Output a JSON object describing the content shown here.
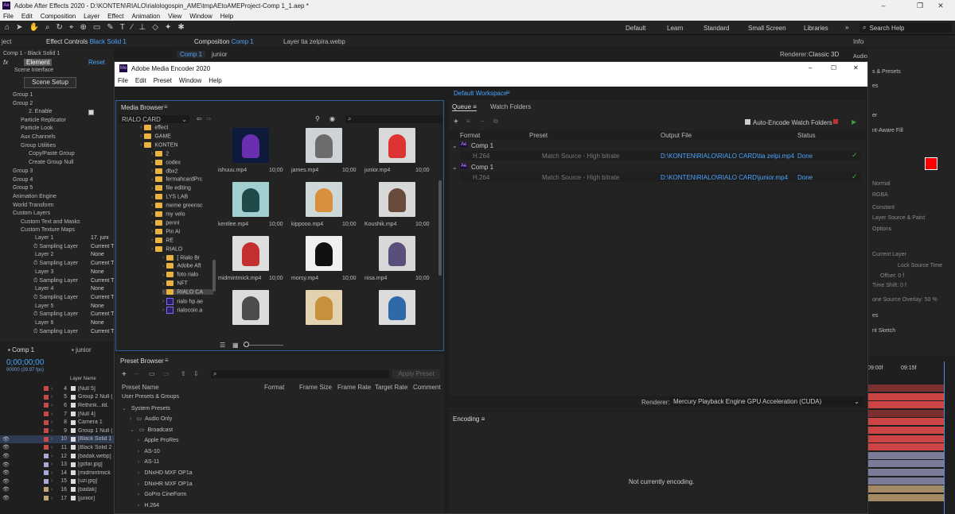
{
  "ae": {
    "title": "Adobe After Effects 2020 - D:\\KONTEN\\RIALO\\rialologospin_AME\\tmpAEtoAMEProject-Comp 1_1.aep *",
    "menu": [
      "File",
      "Edit",
      "Composition",
      "Layer",
      "Effect",
      "Animation",
      "View",
      "Window",
      "Help"
    ],
    "workspaces": [
      "Default",
      "Learn",
      "Standard",
      "Small Screen",
      "Libraries"
    ],
    "search_placeholder": "Search Help",
    "effect_controls_tab": "Effect Controls",
    "effect_controls_layer": "Black Solid 1",
    "comp_tab": "Composition",
    "comp_name": "Comp 1",
    "layer_tab": "Layer tia zelpira.webp",
    "comp_subtabs": [
      "Comp 1",
      "junior"
    ],
    "renderer_label": "Renderer:",
    "renderer_value": "Classic 3D",
    "panel_left": "ject",
    "effects_header": "Comp 1 - Black Solid 1",
    "element_label": "Element",
    "reset_label": "Reset",
    "fx_rows": [
      "Scene Interface",
      "Group 1",
      "Group 2",
      "2. Enable",
      "Particle Replicator",
      "Particle Look",
      "Aux Channels",
      "Group Utilities",
      "Copy/Paste Group",
      "Create Group Null",
      "Group 3",
      "Group 4",
      "Group 5",
      "Animation Engine",
      "World Transform",
      "Custom Layers",
      "Custom Text and Masks",
      "Custom Texture Maps"
    ],
    "scene_setup": "Scene Setup",
    "tex_layers": [
      [
        "Layer 1",
        "17. juni"
      ],
      [
        "Sampling Layer",
        "Current T"
      ],
      [
        "Layer 2",
        "None"
      ],
      [
        "Sampling Layer",
        "Current T"
      ],
      [
        "Layer 3",
        "None"
      ],
      [
        "Sampling Layer",
        "Current T"
      ],
      [
        "Layer 4",
        "None"
      ],
      [
        "Sampling Layer",
        "Current T"
      ],
      [
        "Layer 5",
        "None"
      ],
      [
        "Sampling Layer",
        "Current T"
      ],
      [
        "Layer 6",
        "None"
      ],
      [
        "Sampling Layer",
        "Current T"
      ]
    ],
    "timeline_tabs": [
      "Comp 1",
      "junior"
    ],
    "timecode": "0;00;00;00",
    "timecode_sub": "00000 (29.97 fps)",
    "layer_name_header": "Layer Name",
    "layers": [
      {
        "n": "4",
        "name": "[Null 5]",
        "c": "#c94848"
      },
      {
        "n": "5",
        "name": "Group 2 Null (",
        "c": "#c94848"
      },
      {
        "n": "6",
        "name": "Rethink...ild.",
        "c": "#c94848"
      },
      {
        "n": "7",
        "name": "[Null 4]",
        "c": "#c94848"
      },
      {
        "n": "8",
        "name": "Camera 1",
        "c": "#c94848"
      },
      {
        "n": "9",
        "name": "Group 1 Null (",
        "c": "#c94848"
      },
      {
        "n": "10",
        "name": "[Black Solid 1",
        "c": "#c94848"
      },
      {
        "n": "11",
        "name": "[Black Solid 2",
        "c": "#c94848"
      },
      {
        "n": "12",
        "name": "[badak.webp]",
        "c": "#a9a9d6"
      },
      {
        "n": "13",
        "name": "[gofar.jpg]",
        "c": "#a9a9d6"
      },
      {
        "n": "14",
        "name": "[midmintmick",
        "c": "#a9a9d6"
      },
      {
        "n": "15",
        "name": "[uzi.jpg]",
        "c": "#a9a9d6"
      },
      {
        "n": "16",
        "name": "[badak]",
        "c": "#c2a878"
      },
      {
        "n": "17",
        "name": "[junior]",
        "c": "#c2a878"
      }
    ],
    "right_panel": [
      "Info",
      "Audio",
      "s & Presets",
      "es",
      "er",
      "nt-Aware Fill",
      "Normal",
      "RGBA",
      "Constant",
      "Layer Source & Paint",
      "Options",
      "Current Layer",
      "Lock Source Time",
      "Offset: 0 f",
      "Time Shift: 0 f",
      "one Source Overlay: 50 %",
      "es",
      "nt Sketch"
    ],
    "ruler": [
      "09:00f",
      "09:15f"
    ]
  },
  "ame": {
    "title": "Adobe Media Encoder 2020",
    "menu": [
      "File",
      "Edit",
      "Preset",
      "Window",
      "Help"
    ],
    "workspace": "Default Workspace",
    "media_browser": "Media Browser",
    "location": "RIALO CARD",
    "folders": [
      [
        "effect",
        1
      ],
      [
        "GAME",
        1
      ],
      [
        "KONTEN",
        1
      ],
      [
        "2",
        2
      ],
      [
        "codex",
        2
      ],
      [
        "dbx2",
        2
      ],
      [
        "fermahcardPrc",
        2
      ],
      [
        "file editing",
        2
      ],
      [
        "LYS LAB",
        2
      ],
      [
        "meme greensc",
        2
      ],
      [
        "my velo",
        2
      ],
      [
        "penni",
        2
      ],
      [
        "Pin Ai",
        2
      ],
      [
        "RE",
        2
      ],
      [
        "RIALO",
        2
      ],
      [
        "[ Rialo Br",
        3
      ],
      [
        "Adobe Aft",
        3
      ],
      [
        "foto rialo",
        3
      ],
      [
        "NFT",
        3
      ],
      [
        "RIALO CA",
        3
      ],
      [
        "rialo hp.ae",
        3
      ],
      [
        "rialocoin.a",
        3
      ]
    ],
    "media": [
      {
        "name": "ishuuu.mp4",
        "dur": "10;00"
      },
      {
        "name": "james.mp4",
        "dur": "10;00"
      },
      {
        "name": "junior.mp4",
        "dur": "10;00"
      },
      {
        "name": "kentlee.mp4",
        "dur": "10;00"
      },
      {
        "name": "kippooo.mp4",
        "dur": "10;00"
      },
      {
        "name": "Koushik.mp4",
        "dur": "10;00"
      },
      {
        "name": "midmintmick.mp4",
        "dur": "10;00"
      },
      {
        "name": "morsy.mp4",
        "dur": "10;00"
      },
      {
        "name": "nisa.mp4",
        "dur": "10;00"
      }
    ],
    "queue_tab": "Queue",
    "watch_tab": "Watch Folders",
    "auto_encode": "Auto-Encode Watch Folders",
    "queue_headers": [
      "Format",
      "Preset",
      "Output File",
      "Status"
    ],
    "queue": [
      {
        "comp": "Comp 1",
        "format": "H.264",
        "preset": "Match Source - High bitrate",
        "output": "D:\\KONTEN\\RIALO\\RIALO CARD\\tia zelpi.mp4",
        "status": "Done"
      },
      {
        "comp": "Comp 1",
        "format": "H.264",
        "preset": "Match Source - High bitrate",
        "output": "D:\\KONTEN\\RIALO\\RIALO CARD\\junior.mp4",
        "status": "Done"
      }
    ],
    "renderer_label": "Renderer:",
    "renderer_value": "Mercury Playback Engine GPU Acceleration (CUDA)",
    "preset_browser": "Preset Browser",
    "apply_preset": "Apply Preset",
    "preset_headers": [
      "Preset Name",
      "Format",
      "Frame Size",
      "Frame Rate",
      "Target Rate",
      "Comment"
    ],
    "preset_rows": [
      [
        "User Presets & Groups",
        0
      ],
      [
        "System Presets",
        0
      ],
      [
        "Audio Only",
        1
      ],
      [
        "Broadcast",
        1
      ],
      [
        "Apple ProRes",
        2
      ],
      [
        "AS-10",
        2
      ],
      [
        "AS-11",
        2
      ],
      [
        "DNxHD MXF OP1a",
        2
      ],
      [
        "DNxHR MXF OP1a",
        2
      ],
      [
        "GoPro CineForm",
        2
      ],
      [
        "H.264",
        2
      ]
    ],
    "encoding_tab": "Encoding",
    "not_encoding": "Not currently encoding."
  }
}
